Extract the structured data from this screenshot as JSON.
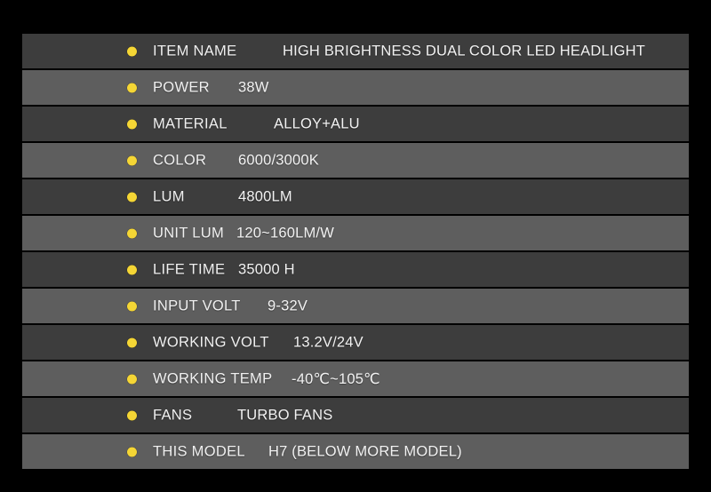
{
  "spec_table": {
    "bullet_color": "#f5d635",
    "row_shades": {
      "dark": "#3d3d3d",
      "light": "#5e5e5e"
    },
    "background_color": "#000000",
    "text_color": "#f0f0f0",
    "rows": [
      {
        "label": "ITEM NAME",
        "value": "HIGH BRIGHTNESS DUAL COLOR LED HEADLIGHT",
        "value_offset": 293,
        "shade": "dark"
      },
      {
        "label": "POWER",
        "value": "38W",
        "value_offset": 243,
        "shade": "light"
      },
      {
        "label": "MATERIAL",
        "value": "ALLOY+ALU",
        "value_offset": 283,
        "shade": "dark"
      },
      {
        "label": "COLOR",
        "value": "6000/3000K",
        "value_offset": 243,
        "shade": "light"
      },
      {
        "label": "LUM",
        "value": "4800LM",
        "value_offset": 243,
        "shade": "dark"
      },
      {
        "label": "UNIT LUM",
        "value": "120~160LM/W",
        "value_offset": 241,
        "shade": "light"
      },
      {
        "label": "LIFE TIME",
        "value": "35000 H",
        "value_offset": 243,
        "shade": "dark"
      },
      {
        "label": "INPUT VOLT",
        "value": "9-32V",
        "value_offset": 276,
        "shade": "light"
      },
      {
        "label": "WORKING VOLT",
        "value": "13.2V/24V",
        "value_offset": 305,
        "shade": "dark"
      },
      {
        "label": "WORKING TEMP",
        "value": "-40℃~105℃",
        "value_offset": 303,
        "shade": "light"
      },
      {
        "label": "FANS",
        "value": "TURBO FANS",
        "value_offset": 242,
        "shade": "dark"
      },
      {
        "label": "THIS MODEL",
        "value": "H7 (BELOW MORE MODEL)",
        "value_offset": 277,
        "shade": "light"
      }
    ]
  }
}
